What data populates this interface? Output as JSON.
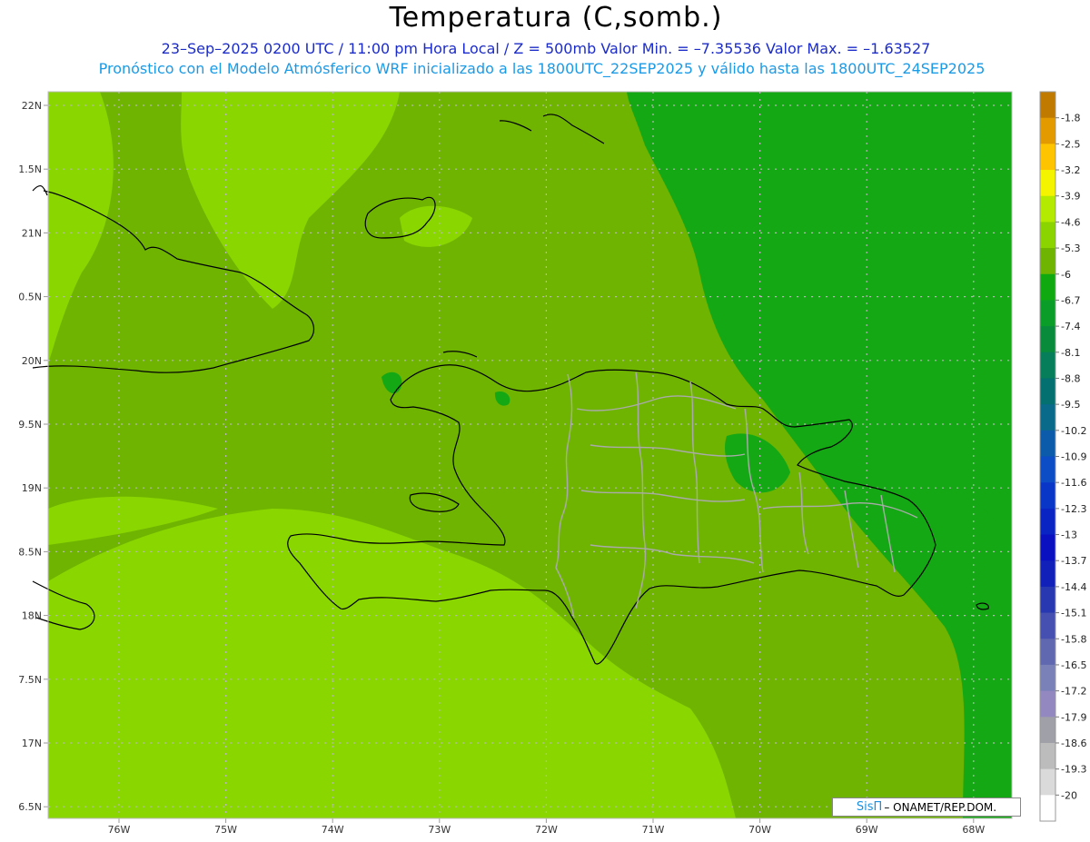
{
  "title": "Temperatura (C,somb.)",
  "subtitle_line1": "23–Sep–2025  0200 UTC / 11:00 pm Hora Local / Z = 500mb  Valor Min. = –7.35536  Valor Max. = –1.63527",
  "subtitle_line2": "Pronóstico con el Modelo Atmósferico WRF inicializado a las 1800UTC_22SEP2025 y válido hasta las  1800UTC_24SEP2025",
  "credit": {
    "brand": "SisΠ",
    "text": "– ONAMET/REP.DOM."
  },
  "map_data": {
    "lon_labels": [
      "76W",
      "75W",
      "74W",
      "73W",
      "72W",
      "71W",
      "70W",
      "69W",
      "68W"
    ],
    "lat_labels": [
      "22N",
      "1.5N",
      "21N",
      "0.5N",
      "20N",
      "9.5N",
      "19N",
      "8.5N",
      "18N",
      "7.5N",
      "17N",
      "6.5N"
    ],
    "colorbar": {
      "labels": [
        "-1.8",
        "-2.5",
        "-3.2",
        "-3.9",
        "-4.6",
        "-5.3",
        "-6",
        "-6.7",
        "-7.4",
        "-8.1",
        "-8.8",
        "-9.5",
        "-10.2",
        "-10.9",
        "-11.6",
        "-12.3",
        "-13",
        "-13.7",
        "-14.4",
        "-15.1",
        "-15.8",
        "-16.5",
        "-17.2",
        "-17.9",
        "-18.6",
        "-19.3",
        "-20"
      ],
      "colors": [
        "#c07a00",
        "#e29a00",
        "#ffc400",
        "#f4f400",
        "#b4ea00",
        "#8cd400",
        "#6eb400",
        "#10aa10",
        "#0a9e28",
        "#088c3c",
        "#067e5a",
        "#047070",
        "#0a6a8a",
        "#0c5aaa",
        "#0c4cc4",
        "#0a36c8",
        "#0a24c4",
        "#0a10c0",
        "#1020b8",
        "#2838b0",
        "#4650b0",
        "#6068b0",
        "#7a80b8",
        "#9488c0",
        "#a0a0a8",
        "#bcbcbc",
        "#dadada",
        "#ffffff"
      ]
    },
    "colors": {
      "light_green": "#8ad600",
      "mid_green": "#6fb400",
      "dark_green": "#14a814",
      "coast": "#000000",
      "province_border": "#aaaaaa",
      "grid": "#b8b8b8"
    }
  }
}
